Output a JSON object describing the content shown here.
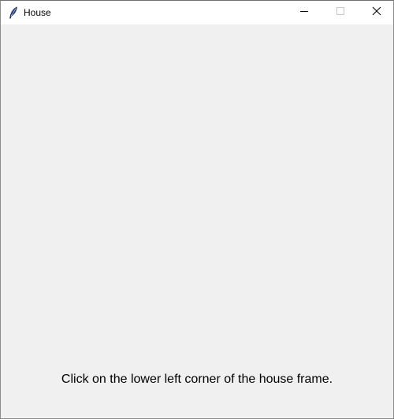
{
  "window": {
    "title": "House",
    "icon": "feather-icon",
    "controls": {
      "minimize_icon": "minimize-icon",
      "maximize_icon": "maximize-icon",
      "close_icon": "close-icon"
    }
  },
  "canvas": {
    "background": "#f0f0f0",
    "instruction": "Click on the lower left corner of the house frame."
  }
}
